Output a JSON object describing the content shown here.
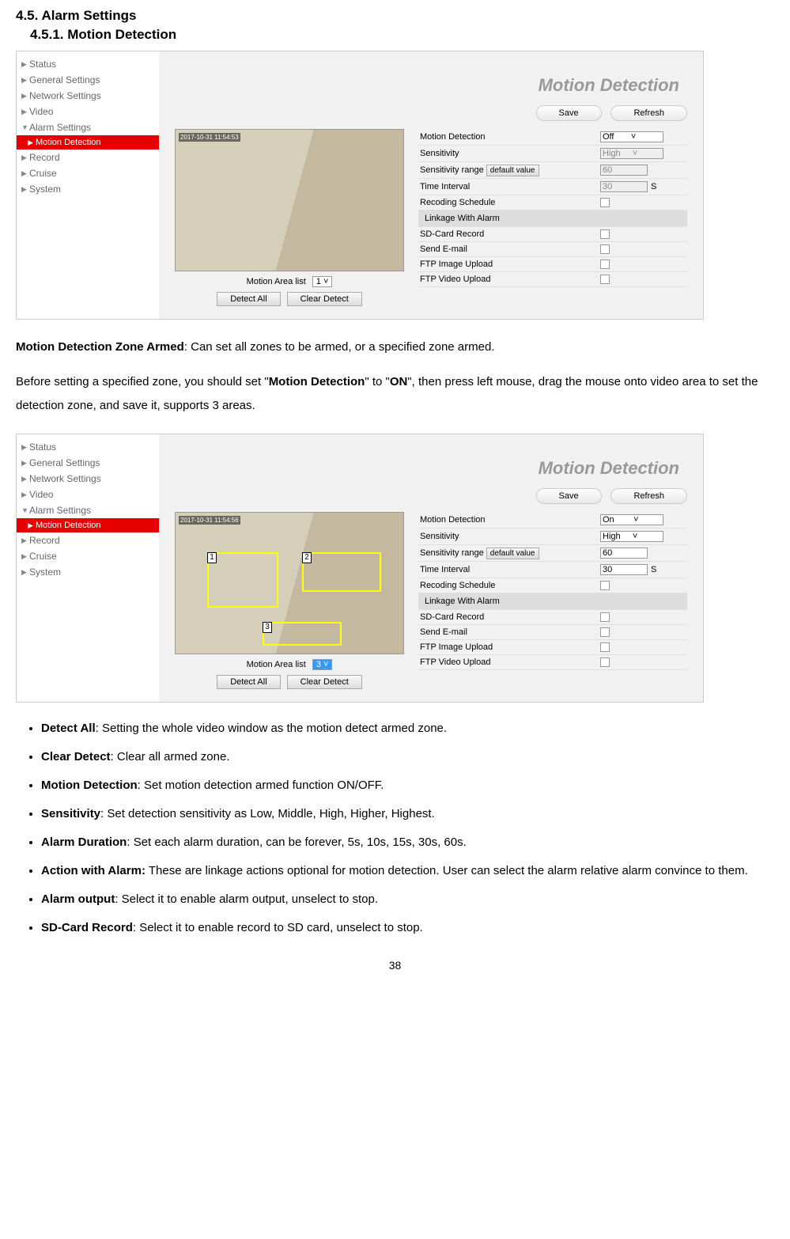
{
  "headings": {
    "section": "4.5.    Alarm Settings",
    "subsection": "4.5.1. Motion Detection"
  },
  "sidebar": {
    "items": [
      {
        "label": "Status",
        "expanded": false
      },
      {
        "label": "General Settings",
        "expanded": false
      },
      {
        "label": "Network Settings",
        "expanded": false
      },
      {
        "label": "Video",
        "expanded": false
      },
      {
        "label": "Alarm Settings",
        "expanded": true
      },
      {
        "label": "Motion Detection",
        "sub": true,
        "active": true
      },
      {
        "label": "Record",
        "expanded": false
      },
      {
        "label": "Cruise",
        "expanded": false
      },
      {
        "label": "System",
        "expanded": false
      }
    ]
  },
  "screenshot1": {
    "title": "Motion Detection",
    "buttons": {
      "save": "Save",
      "refresh": "Refresh"
    },
    "video": {
      "timestamp": "2017-10-31 11:54:53",
      "areaListLabel": "Motion Area list",
      "areaListValue": "1",
      "detectAll": "Detect All",
      "clearDetect": "Clear Detect"
    },
    "settings": {
      "motionDetection": {
        "label": "Motion Detection",
        "value": "Off"
      },
      "sensitivity": {
        "label": "Sensitivity",
        "value": "High"
      },
      "sensitivityRange": {
        "label": "Sensitivity range",
        "btn": "default value",
        "value": "60"
      },
      "timeInterval": {
        "label": "Time Interval",
        "value": "30",
        "unit": "S"
      },
      "recodingSchedule": {
        "label": "Recoding Schedule"
      },
      "linkage": {
        "label": "Linkage With Alarm"
      },
      "sdCard": {
        "label": "SD-Card Record"
      },
      "sendEmail": {
        "label": "Send E-mail"
      },
      "ftpImage": {
        "label": "FTP Image Upload"
      },
      "ftpVideo": {
        "label": "FTP Video Upload"
      }
    }
  },
  "bodyText": {
    "p1_bold": "Motion Detection Zone Armed",
    "p1_rest": ": Can set all zones to be armed, or a specified zone armed.",
    "p2_a": "Before setting a specified zone, you should set \"",
    "p2_b1": "Motion Detection",
    "p2_c": "\" to \"",
    "p2_b2": "ON",
    "p2_d": "\", then press left mouse, drag the mouse onto video area to set the detection zone, and save it, supports 3 areas."
  },
  "screenshot2": {
    "title": "Motion Detection",
    "buttons": {
      "save": "Save",
      "refresh": "Refresh"
    },
    "video": {
      "timestamp": "2017-10-31 11:54:56",
      "zones": [
        "1",
        "2",
        "3"
      ],
      "areaListLabel": "Motion Area list",
      "areaListValue": "3",
      "detectAll": "Detect All",
      "clearDetect": "Clear Detect"
    },
    "settings": {
      "motionDetection": {
        "label": "Motion Detection",
        "value": "On"
      },
      "sensitivity": {
        "label": "Sensitivity",
        "value": "High"
      },
      "sensitivityRange": {
        "label": "Sensitivity range",
        "btn": "default value",
        "value": "60"
      },
      "timeInterval": {
        "label": "Time Interval",
        "value": "30",
        "unit": "S"
      },
      "recodingSchedule": {
        "label": "Recoding Schedule"
      },
      "linkage": {
        "label": "Linkage With Alarm"
      },
      "sdCard": {
        "label": "SD-Card Record"
      },
      "sendEmail": {
        "label": "Send E-mail"
      },
      "ftpImage": {
        "label": "FTP Image Upload"
      },
      "ftpVideo": {
        "label": "FTP Video Upload"
      }
    }
  },
  "bullets": [
    {
      "bold": "Detect All",
      "rest": ": Setting the whole video window as the motion detect armed zone."
    },
    {
      "bold": "Clear Detect",
      "rest": ": Clear all armed zone."
    },
    {
      "bold": "Motion Detection",
      "rest": ": Set motion detection armed function ON/OFF."
    },
    {
      "bold": "Sensitivity",
      "rest": ": Set detection sensitivity as Low, Middle, High, Higher, Highest."
    },
    {
      "bold": "Alarm Duration",
      "rest": ": Set each alarm duration, can be forever, 5s, 10s, 15s, 30s, 60s."
    },
    {
      "bold": "Action with Alarm:",
      "rest": " These are linkage actions optional for motion detection. User can select the alarm relative alarm convince to them."
    },
    {
      "bold": "Alarm output",
      "rest": ": Select it to enable alarm output, unselect to stop."
    },
    {
      "bold": "SD-Card Record",
      "rest": ": Select it to enable record to SD card, unselect to stop."
    }
  ],
  "pageNumber": "38"
}
